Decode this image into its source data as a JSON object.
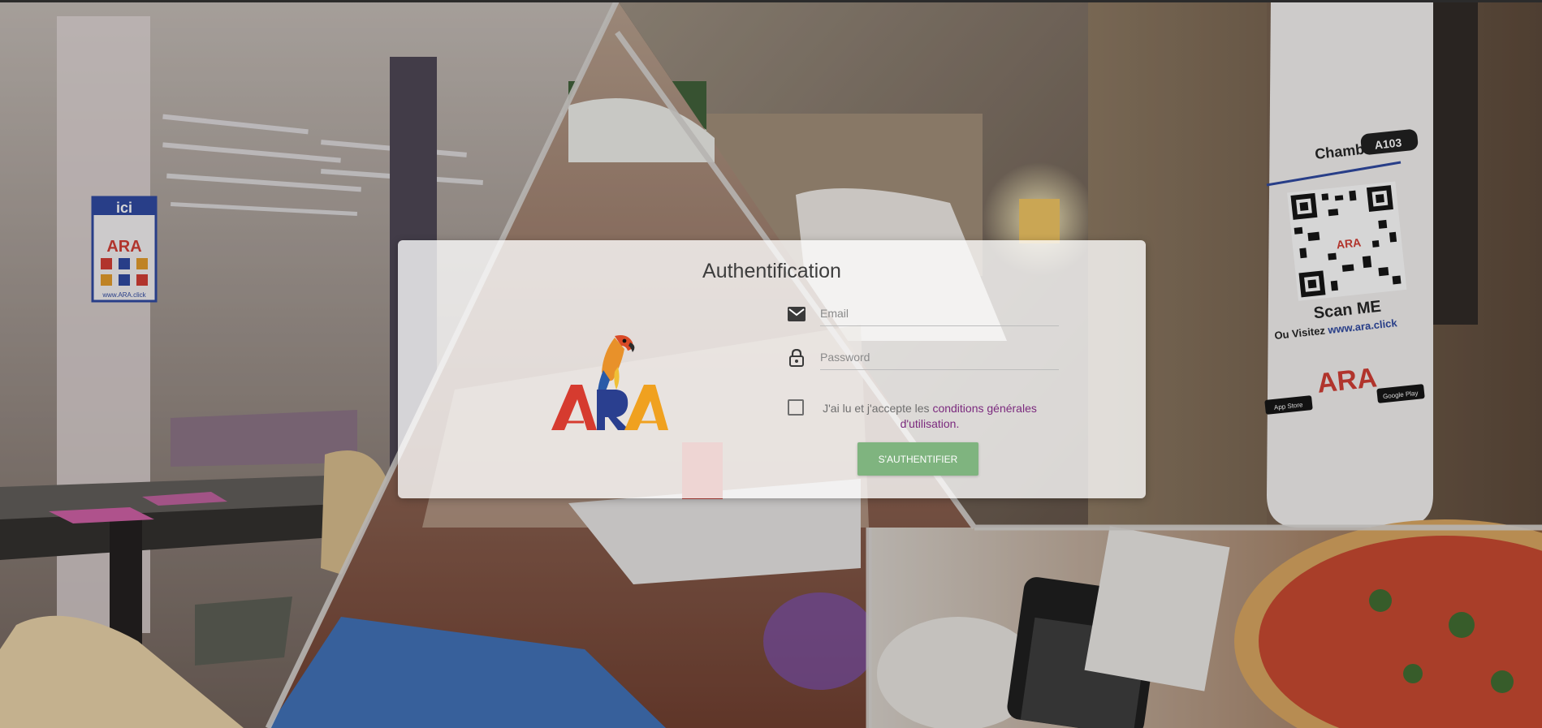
{
  "auth": {
    "title": "Authentification",
    "email_placeholder": "Email",
    "password_placeholder": "Password",
    "terms_prefix": "J'ai lu et j'accepte les ",
    "terms_link": "conditions générales d'utilisation.",
    "submit_label": "S'AUTHENTIFIER"
  },
  "brand": {
    "logo_text": "ARA",
    "colors": {
      "a_left": "#d63b2f",
      "r_middle": "#2a3f8f",
      "a_right": "#f0a11f",
      "parrot_body": "#e8912a",
      "parrot_head": "#d94a27"
    }
  },
  "background": {
    "door_hanger": {
      "room_label": "Chambre",
      "room_number": "A103",
      "scan_label": "Scan ME",
      "visit_prefix": "Ou Visitez ",
      "visit_url": "www.ara.click",
      "store_1": "App Store",
      "store_2": "Google Play"
    },
    "sign": {
      "header": "ici",
      "footer": "www.ARA.click"
    }
  },
  "theme": {
    "button_color": "#7fb47f",
    "link_color": "#7b2a7e"
  }
}
